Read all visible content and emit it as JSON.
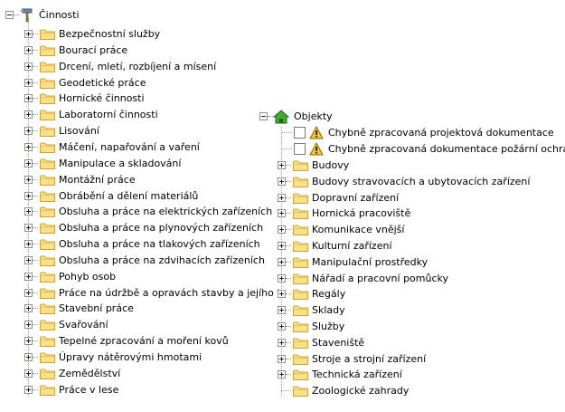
{
  "left_tree": {
    "root_label": "Činnosti",
    "items": [
      "Bezpečnostní služby",
      "Bourací práce",
      "Drcení, mletí, rozbíjení a mísení",
      "Geodetické práce",
      "Hornické činnosti",
      "Laboratorní činnosti",
      "Lisování",
      "Máčení, napařování a vaření",
      "Manipulace a skladování",
      "Montážní práce",
      "Obrábění a dělení materiálů",
      "Obsluha a práce na elektrických zařízeních",
      "Obsluha a práce na plynových zařízeních",
      "Obsluha a práce na tlakových zařízeních",
      "Obsluha a práce na zdvihacích zařízeních",
      "Pohyb osob",
      "Práce na údržbě a opravách stavby a jejího t",
      "Stavební práce",
      "Svařování",
      "Tepelné zpracování a moření kovů",
      "Úpravy nátěrovými hmotami",
      "Zemědělství",
      "Práce v lese"
    ]
  },
  "right_tree": {
    "root_label": "Objekty",
    "warnings": [
      "Chybně zpracovaná projektová dokumentace",
      "Chybně zpracovaná dokumentace požární ochrany"
    ],
    "items": [
      "Budovy",
      "Budovy stravovacích a ubytovacích zařízení",
      "Dopravní zařízení",
      "Hornická pracoviště",
      "Komunikace vnější",
      "Kulturní zařízení",
      "Manipulační prostředky",
      "Nářadí a pracovní pomůcky",
      "Regály",
      "Sklady",
      "Služby",
      "Staveniště",
      "Stroje a strojní zařízení",
      "Technická zařízení",
      "Zoologické zahrady"
    ],
    "last_item_leaf": true
  },
  "icons": {
    "root_left": "tools-icon",
    "root_right": "house-icon",
    "folder": "folder-icon",
    "warning": "warning-icon"
  },
  "colors": {
    "folder_fill": "#fbe08a",
    "folder_stroke": "#c9a33a",
    "house_green": "#3faa2e",
    "warning_yellow": "#f7c925",
    "tree_lines": "#9a9a9a"
  }
}
